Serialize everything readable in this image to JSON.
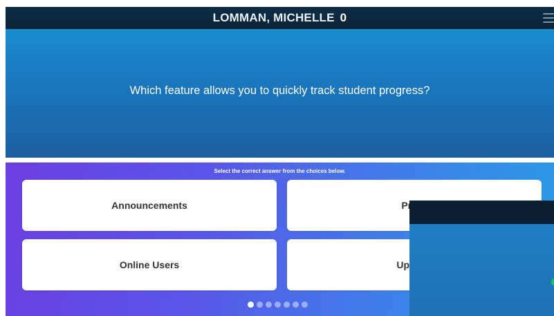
{
  "header": {
    "player_name": "LOMMAN, MICHELLE",
    "score": "0",
    "menu_icon": "hamburger-menu-icon"
  },
  "question": {
    "text": "Which feature allows you to quickly track student progress?"
  },
  "answers": {
    "instruction": "Select the correct answer from the choices below.",
    "choices": [
      {
        "label": "Announcements"
      },
      {
        "label": "Progr"
      },
      {
        "label": "Online Users"
      },
      {
        "label": "Upcomi"
      }
    ]
  },
  "pagination": {
    "total": 7,
    "active_index": 0
  },
  "colors": {
    "header_bg": "#0f2d46",
    "question_bg": "#1a7fc4",
    "answer_bg_start": "#6b3ee0",
    "answer_bg_end": "#2a9be6",
    "overlay_indicator": "#22c26a"
  }
}
